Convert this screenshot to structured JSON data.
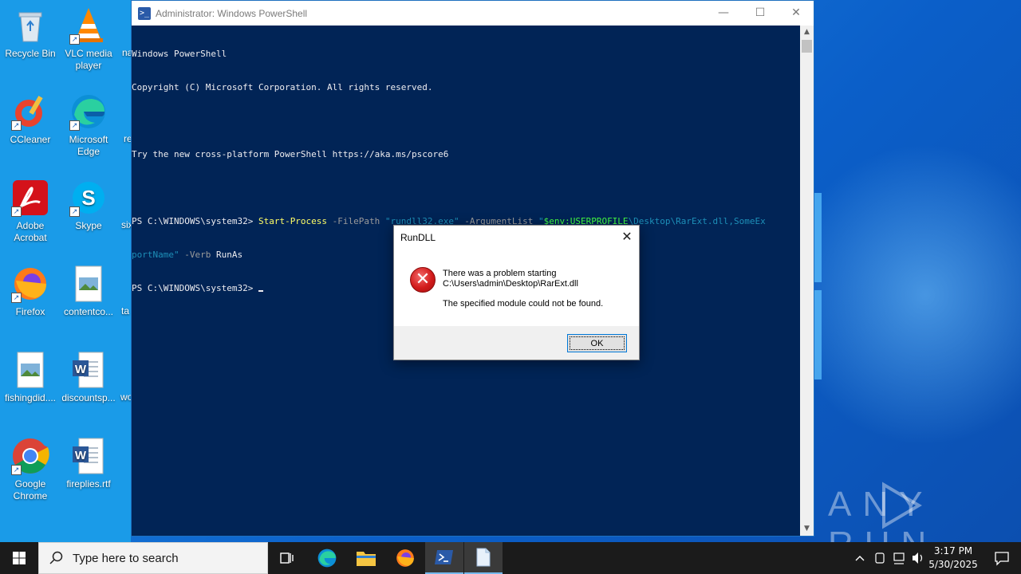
{
  "desktop": {
    "icons": [
      {
        "label": "Recycle Bin",
        "icon": "recycle-bin-icon"
      },
      {
        "label": "VLC media player",
        "icon": "vlc-icon"
      },
      {
        "label": "CCleaner",
        "icon": "ccleaner-icon"
      },
      {
        "label": "Microsoft Edge",
        "icon": "edge-icon"
      },
      {
        "label": "Adobe Acrobat",
        "icon": "acrobat-icon"
      },
      {
        "label": "Skype",
        "icon": "skype-icon"
      },
      {
        "label": "Firefox",
        "icon": "firefox-icon"
      },
      {
        "label": "contentco...",
        "icon": "image-file-icon"
      },
      {
        "label": "fishingdid....",
        "icon": "image-file-icon"
      },
      {
        "label": "discountsp...",
        "icon": "word-doc-icon"
      },
      {
        "label": "Google Chrome",
        "icon": "chrome-icon"
      },
      {
        "label": "fireplies.rtf",
        "icon": "word-doc-icon"
      }
    ],
    "partial_labels": [
      "na",
      "re",
      "six",
      "ta",
      "wo"
    ]
  },
  "powershell": {
    "title": "Administrator: Windows PowerShell",
    "console": {
      "line1": "Windows PowerShell",
      "line2": "Copyright (C) Microsoft Corporation. All rights reserved.",
      "line3": "Try the new cross-platform PowerShell https://aka.ms/pscore6",
      "prompt": "PS C:\\WINDOWS\\system32> ",
      "cmd": "Start-Process",
      "p1": " -FilePath ",
      "s1": "\"rundll32.exe\"",
      "p2": " -ArgumentList ",
      "s2a": "\"",
      "var": "$env:USERPROFILE",
      "s2b": "\\Desktop\\RarExt.dll,SomeEx",
      "s2c": "portName\"",
      "p3": " -Verb ",
      "verb": "RunAs",
      "prompt2": "PS C:\\WINDOWS\\system32> "
    }
  },
  "dialog": {
    "title": "RunDLL",
    "message_line1": "There was a problem starting",
    "message_line2": "C:\\Users\\admin\\Desktop\\RarExt.dll",
    "message_line3": "The specified module could not be found.",
    "ok_label": "OK"
  },
  "watermark": "ANY RUN",
  "taskbar": {
    "search_placeholder": "Type here to search",
    "time": "3:17 PM",
    "date": "5/30/2025"
  }
}
